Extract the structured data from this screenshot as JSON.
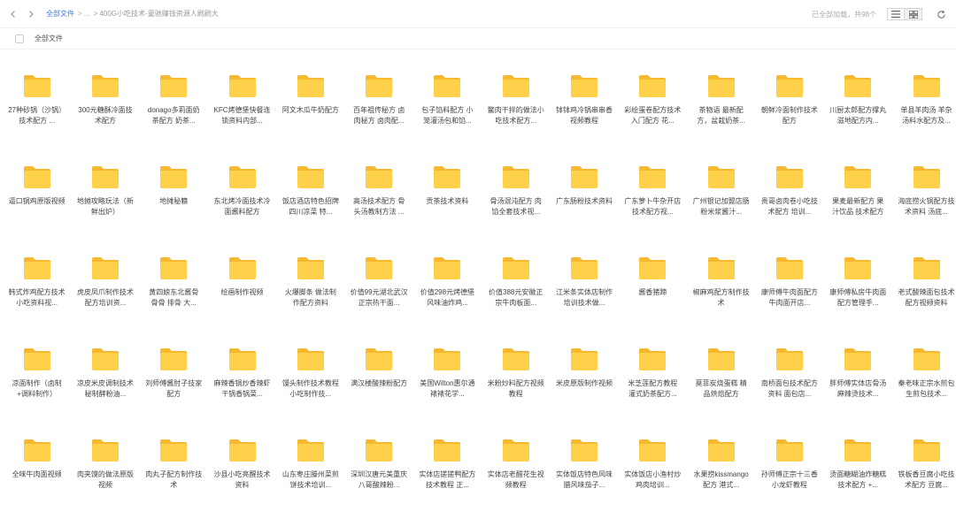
{
  "header": {
    "back_icon": "chevron-left-icon",
    "forward_icon": "chevron-right-icon",
    "breadcrumb_root": "全部文件",
    "breadcrumb_sep": "> ...",
    "breadcrumb_current": "> 400G小吃技术-童驰赚钱资源人刷刷大",
    "loaded_status": "已全部加载，共98个",
    "list_view_icon": "list-icon",
    "grid_view_icon": "grid-icon",
    "refresh_icon": "refresh-icon"
  },
  "subbar": {
    "all_files_label": "全部文件"
  },
  "colors": {
    "folder_body": "#FFD04A",
    "folder_tab": "#F5B82E",
    "link": "#3B7EF0"
  },
  "folders": [
    "27种砂锅（沙锅）技术配方 ...",
    "300元糖酥冷面技术配方",
    "donago多莉面奶茶配方 奶茶...",
    "KFC烤德堡快餐连锁资料内部...",
    "阿文木瓜牛奶配方",
    "百年祖传秘方 卤肉秘方 卤肉配...",
    "包子馅料配方 小笼灌汤包和馅...",
    "鳖肉干拌的做法小吃技术配方...",
    "钵钵鸡冷锅串串香视频教程",
    "彩绘蛋卷配方技术入门配方 花...",
    "茶物语 最新配方，盆栽奶茶...",
    "朝鲜冷面制作技术配方",
    "川厨太郎配方撑丸滋地配方内...",
    "单县羊肉汤 羊杂汤料水配方及...",
    "逼口锅鸡原版视频",
    "地摊攻略玩法（新鲜出炉）",
    "地摊秘籍",
    "东北烤冷面技术冷面酱料配方",
    "饭店酒店特色招牌四川凉菜 特...",
    "高汤技术配方 骨头汤教制方法 ...",
    "贡茶技术资料",
    "骨汤混沌配方 肉馅全套技术视...",
    "广东肠粉技术资料",
    "广东萝卜牛杂开店技术配方视...",
    "广州银记加盟店肠粉米浆酱汁...",
    "贵哥卤肉卷小吃技术配方 培训...",
    "果麦最新配方 果汁饮品 技术配方",
    "海底捞火锅配方技术资料 汤底...",
    "韩式炸鸡配方技术小吃资料视...",
    "虎皮凤爪制作技术配方培训资...",
    "黄四娘东北酱骨 骨骨 排骨 大...",
    "绘画制作视频",
    "火爆脚条 做法制作配方资料",
    "价值99元湖北武汉正宗热干面...",
    "价值298元烤德堡风味油炸鸡...",
    "价值388元安徽正宗牛肉板面...",
    "江米条实体店制作培训技术做...",
    "酱香猪蹄",
    "椒麻鸡配方制作技术",
    "康师傅牛肉面配方 牛肉面开店...",
    "康师傅私房牛肉面配方管理手...",
    "老式酸辣面包技术配方视频资料",
    "凉面制作（卤制+调料制作）",
    "凉皮米皮调制技术 秘制酵粉油...",
    "刘师傅酱肘子技家配方",
    "麻辣香锅炒香辣虾干锅香锅菜...",
    "馒头制作技术教程小吃制作技...",
    "满汉楼酸辣粉配方",
    "美国Wilton惠尔通裱裱花学...",
    "米粉炒料配方视频教程",
    "米皮原版制作视频",
    "米芝莲配方教程 灌式奶茶配方...",
    "莫菲炭烧蛋糕 精品烘焙配方",
    "南桥面包技术配方资料 面包店...",
    "胖师傅实体店骨汤麻辣烫技术...",
    "秦老味正宗水煎包生煎包技术...",
    "全味牛肉面视频",
    "肉夹馍的做法原版视频",
    "肉丸子配方制作技术",
    "沙县小吃亮醒技术资料",
    "山东枣庄滕州菜煎饼技术培训...",
    "深圳汉唐元美重庆八哥酸辣粉...",
    "实体店搓搓鸭配方技术教程 正...",
    "实体店老醋花生视频教程",
    "实体饭店特色风味腊风味茄子...",
    "实体饭店小渔村炒鸡肉培训...",
    "水果捞kissmango配方 港式...",
    "孙师傅正宗十三香小龙虾教程",
    "烫面糖糊油炸糖糕技术配方 +...",
    "铁板香豆腐小吃技术配方 豆腐..."
  ]
}
